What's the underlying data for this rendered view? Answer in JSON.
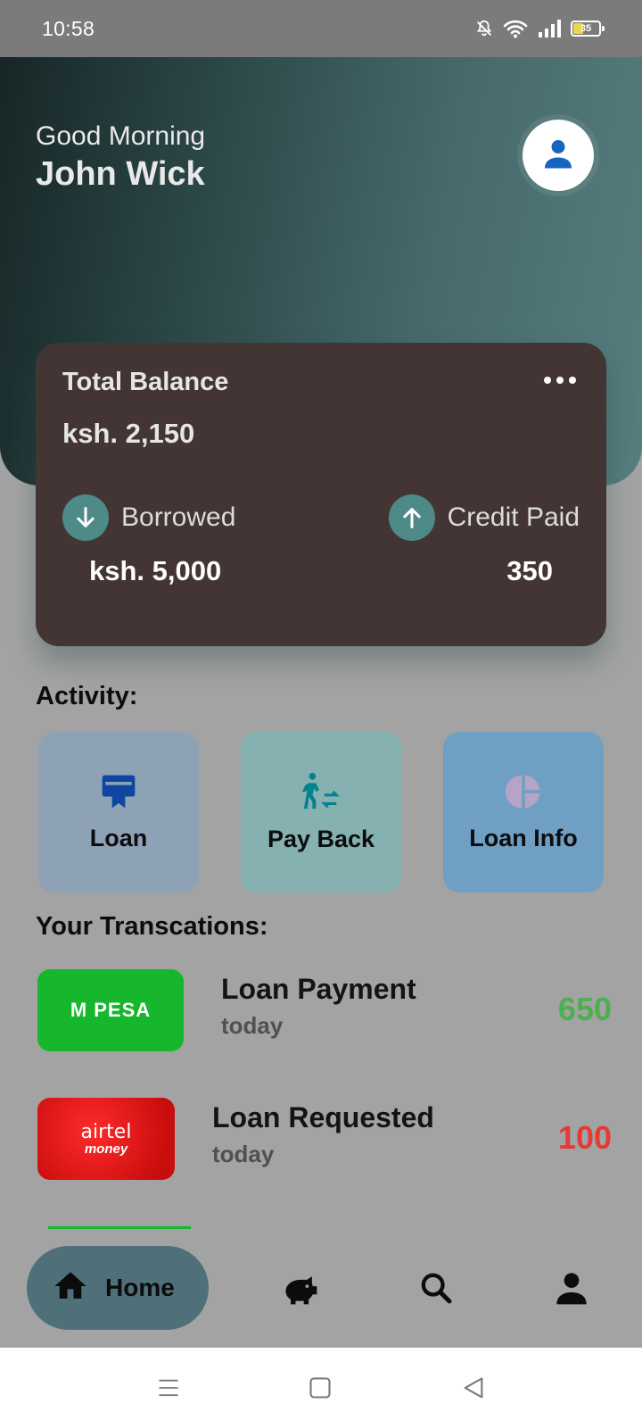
{
  "status_bar": {
    "time": "10:58",
    "battery": "35"
  },
  "header": {
    "greeting": "Good Morning",
    "user_name": "John Wick",
    "avatar_icon": "person-icon"
  },
  "balance_card": {
    "title": "Total Balance",
    "balance": "ksh. 2,150",
    "borrowed_label": "Borrowed",
    "borrowed_value": "ksh. 5,000",
    "paid_label": "Credit Paid",
    "paid_value": "350"
  },
  "activity": {
    "title": "Activity:",
    "tiles": [
      {
        "label": "Loan",
        "icon": "card-icon",
        "color": "#8ea2b5"
      },
      {
        "label": "Pay Back",
        "icon": "walking-transfer-icon",
        "color": "#86b1b1"
      },
      {
        "label": "Loan Info",
        "icon": "pie-chart-icon",
        "color": "#6f9fc3"
      }
    ]
  },
  "transactions": {
    "title": "Your Transcations:",
    "items": [
      {
        "logo_text": "M PESA",
        "name": "Loan Payment",
        "time": "today",
        "amount": "650",
        "amount_color": "#4caf50"
      },
      {
        "logo_text": "airtel",
        "logo_subtext": "money",
        "name": "Loan Requested",
        "time": "today",
        "amount": "100",
        "amount_color": "#e53935"
      }
    ]
  },
  "bottom_nav": {
    "home_label": "Home",
    "items": [
      "home-icon",
      "piggy-bank-icon",
      "search-icon",
      "profile-icon"
    ]
  },
  "colors": {
    "accent": "#4e8a88",
    "card": "#433533",
    "positive": "#4caf50",
    "negative": "#e53935"
  }
}
